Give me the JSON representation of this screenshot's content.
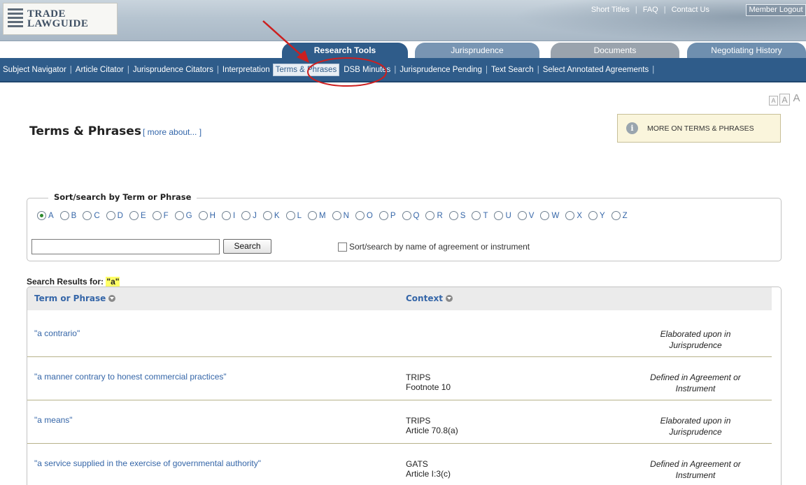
{
  "header": {
    "logo_line1": "TRADE",
    "logo_line2": "LAWGUIDE",
    "links": [
      "Short Titles",
      "FAQ",
      "Contact Us"
    ],
    "logout": "Member Logout"
  },
  "tabs": [
    {
      "label": "Research Tools"
    },
    {
      "label": "Jurisprudence"
    },
    {
      "label": "Documents"
    },
    {
      "label": "Negotiating History"
    }
  ],
  "subnav": [
    "Subject Navigator",
    "Article Citator",
    "Jurisprudence Citators",
    "Interpretation",
    "Terms & Phrases",
    "DSB Minutes",
    "Jurisprudence Pending",
    "Text Search",
    "Select Annotated Agreements"
  ],
  "font_sizes": [
    "A",
    "A",
    "A"
  ],
  "page": {
    "title": "Terms & Phrases",
    "more_about": "[ more about... ]",
    "info_box": "MORE ON TERMS & PHRASES"
  },
  "search": {
    "legend": "Sort/search by Term or Phrase",
    "letters": [
      "A",
      "B",
      "C",
      "D",
      "E",
      "F",
      "G",
      "H",
      "I",
      "J",
      "K",
      "L",
      "M",
      "N",
      "O",
      "P",
      "Q",
      "R",
      "S",
      "T",
      "U",
      "V",
      "W",
      "X",
      "Y",
      "Z"
    ],
    "selected_letter": "A",
    "input_value": "",
    "button": "Search",
    "checkbox_label": "Sort/search by name of agreement or instrument"
  },
  "results": {
    "label": "Search Results for:",
    "query": "\"a\"",
    "col_term": "Term or Phrase",
    "col_context": "Context",
    "rows": [
      {
        "term": "\"a contrario\"",
        "ctx1": "",
        "ctx2": "",
        "type1": "Elaborated upon in",
        "type2": "Jurisprudence"
      },
      {
        "term": "\"a manner contrary to honest commercial practices\"",
        "ctx1": "TRIPS",
        "ctx2": "Footnote 10",
        "type1": "Defined in Agreement or",
        "type2": "Instrument"
      },
      {
        "term": "\"a means\"",
        "ctx1": "TRIPS",
        "ctx2": "Article 70.8(a)",
        "type1": "Elaborated upon in",
        "type2": "Jurisprudence"
      },
      {
        "term": "\"a service supplied in the exercise of governmental authority\"",
        "ctx1": "GATS",
        "ctx2": "Article I:3(c)",
        "type1": "Defined in Agreement or",
        "type2": "Instrument"
      }
    ]
  },
  "colors": {
    "nav_blue": "#2f5c8a",
    "link_blue": "#3566a8",
    "highlight": "#ffff66",
    "annotation_red": "#cc1f1f"
  }
}
